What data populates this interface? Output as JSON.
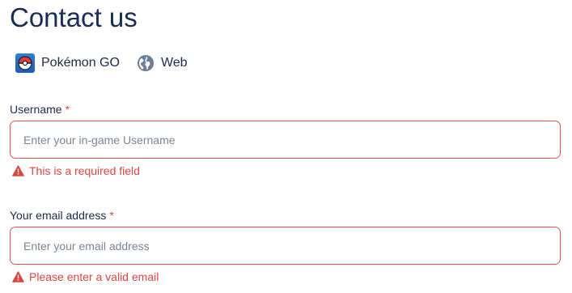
{
  "page": {
    "title": "Contact us"
  },
  "platforms": [
    {
      "label": "Pokémon GO",
      "icon": "pokeball-app-icon"
    },
    {
      "label": "Web",
      "icon": "globe-icon"
    }
  ],
  "form": {
    "username": {
      "label": "Username",
      "required_marker": "*",
      "value": "",
      "placeholder": "Enter your in-game Username",
      "error": "This is a required field"
    },
    "email": {
      "label": "Your email address",
      "required_marker": "*",
      "value": "",
      "placeholder": "Enter your email address",
      "error": "Please enter a valid email"
    }
  },
  "colors": {
    "heading": "#1a2c55",
    "error": "#d9473f",
    "input_border_error": "#e05454",
    "pokemon_icon_bg": "#2f7fd6"
  }
}
